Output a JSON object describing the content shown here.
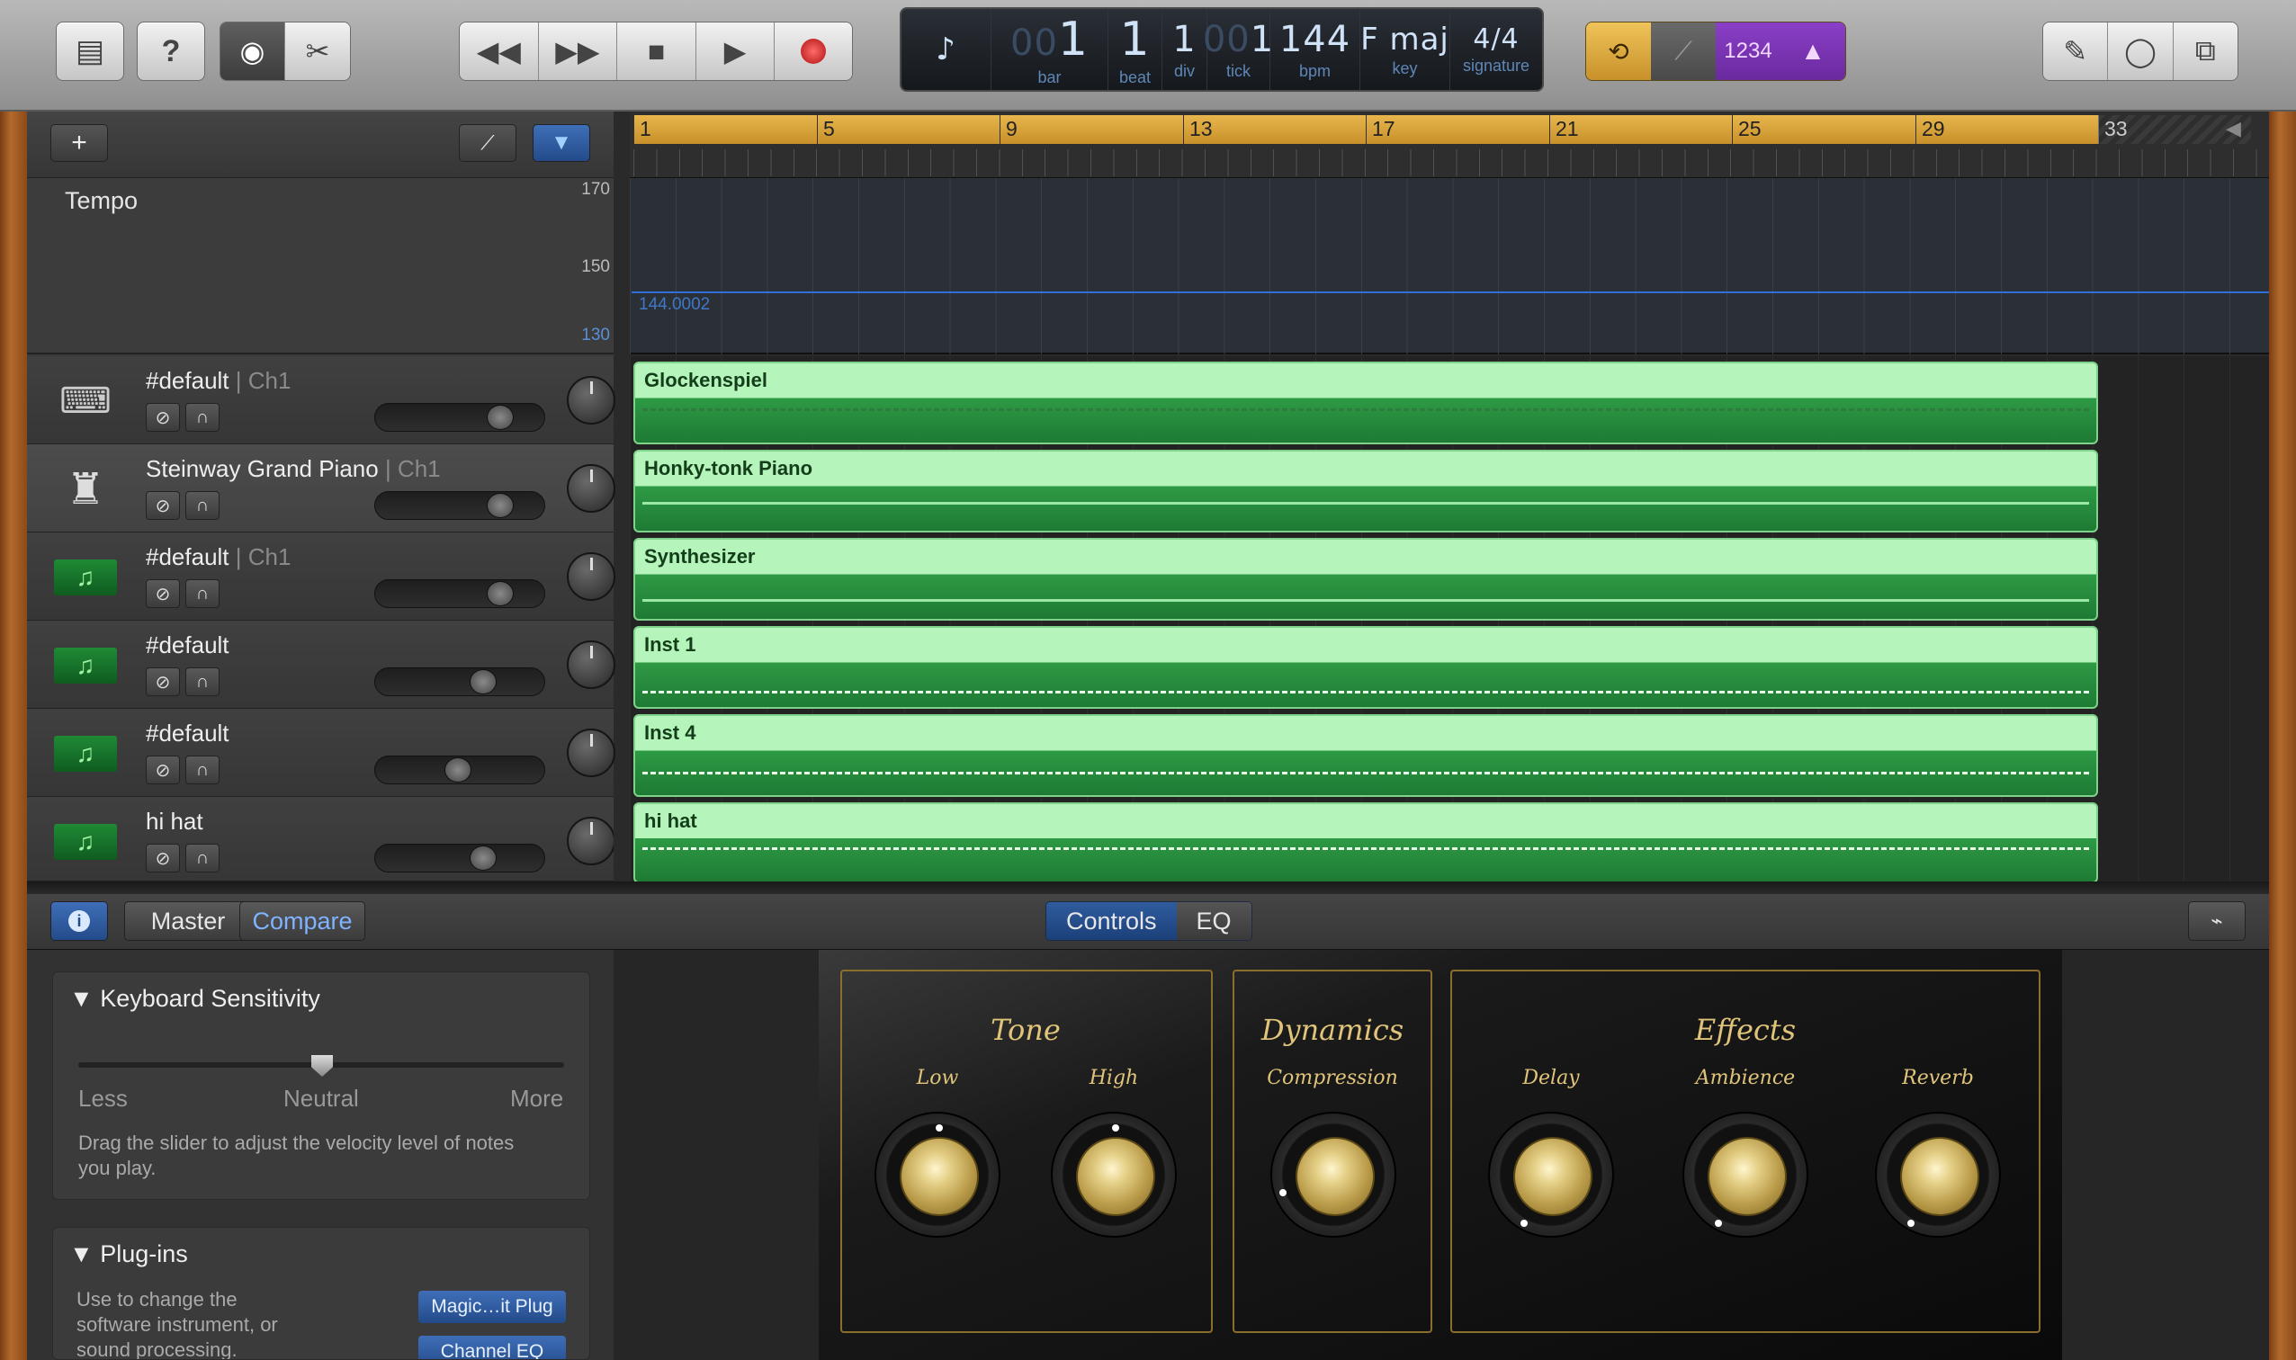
{
  "toolbar": {
    "library_icon": "library-icon",
    "help_label": "?",
    "lcd": {
      "bar_dim": "00",
      "bar": "1",
      "bar_label": "bar",
      "beat": "1",
      "beat_label": "beat",
      "div": "1",
      "div_label": "div",
      "tick_dim": "00",
      "tick": "1",
      "tick_label": "tick",
      "bpm": "144",
      "bpm_label": "bpm",
      "key": "F maj",
      "key_label": "key",
      "signature_top": "4",
      "signature_bottom": "4",
      "signature_label": "signature"
    },
    "count_in_label": "1234",
    "accent_color": "#e8b64d"
  },
  "ruler": {
    "bars": [
      "1",
      "5",
      "9",
      "13",
      "17",
      "21",
      "25",
      "29",
      "33"
    ]
  },
  "tempo_track": {
    "name": "Tempo",
    "ticks": [
      "170",
      "150",
      "130"
    ],
    "value": "144.0002"
  },
  "tracks": [
    {
      "name": "#default",
      "channel": "| Ch1",
      "region": "Glockenspiel",
      "volume": 0.78
    },
    {
      "name": "Steinway Grand Piano",
      "channel": "| Ch1",
      "region": "Honky-tonk Piano",
      "volume": 0.78
    },
    {
      "name": "#default",
      "channel": "| Ch1",
      "region": "Synthesizer",
      "volume": 0.78
    },
    {
      "name": "#default",
      "channel": "",
      "region": "Inst 1",
      "volume": 0.66
    },
    {
      "name": "#default",
      "channel": "",
      "region": "Inst 4",
      "volume": 0.48
    },
    {
      "name": "hi hat",
      "channel": "",
      "region": "hi hat",
      "volume": 0.66
    }
  ],
  "smart_controls": {
    "master_label": "Master",
    "compare_label": "Compare",
    "tabs": [
      "Controls",
      "EQ"
    ],
    "active_tab": "Controls",
    "keyboard_sensitivity": {
      "title": "Keyboard Sensitivity",
      "less": "Less",
      "neutral": "Neutral",
      "more": "More",
      "value": 0.5,
      "desc_line1": "Drag the slider to adjust the velocity level of notes",
      "desc_line2": "you play."
    },
    "plugins": {
      "title": "Plug-ins",
      "desc_line1": "Use to change the",
      "desc_line2": "software instrument, or",
      "desc_line3": "sound processing.",
      "plugin1": "Magic…it Plug",
      "plugin2": "Channel EQ"
    },
    "groups": {
      "tone": "Tone",
      "dynamics": "Dynamics",
      "effects": "Effects"
    },
    "knobs": {
      "low": "Low",
      "high": "High",
      "compression": "Compression",
      "delay": "Delay",
      "ambience": "Ambience",
      "reverb": "Reverb"
    }
  }
}
